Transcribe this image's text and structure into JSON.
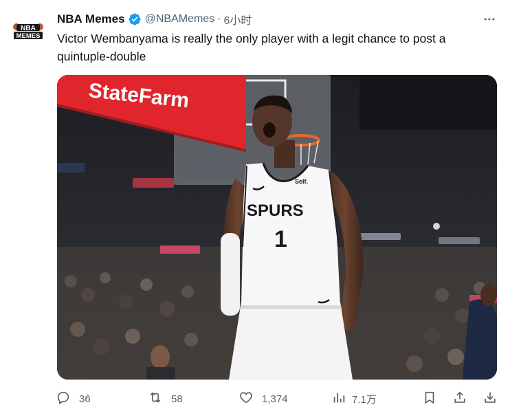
{
  "tweet": {
    "author_name": "NBA Memes",
    "handle": "@NBAMemes",
    "separator": "·",
    "time": "6小时",
    "text": "Victor Wembanyama is really the only player with a legit chance to post a quintuple-double",
    "avatar_text_top": "NBA",
    "avatar_text_bottom": "MEMES",
    "verified_icon": "verified-badge-icon",
    "verified_color": "#1d9bf0"
  },
  "photo": {
    "banner_text": "StateFarm",
    "jersey_team": "SPURS",
    "jersey_number": "1",
    "jersey_sponsor": "Self."
  },
  "actions": {
    "replies": "36",
    "reposts": "58",
    "likes": "1,374",
    "views": "7.1万"
  },
  "colors": {
    "text_primary": "#0f1419",
    "text_secondary": "#536471",
    "brand_blue": "#1d9bf0",
    "statefarm_red": "#e0262c"
  }
}
